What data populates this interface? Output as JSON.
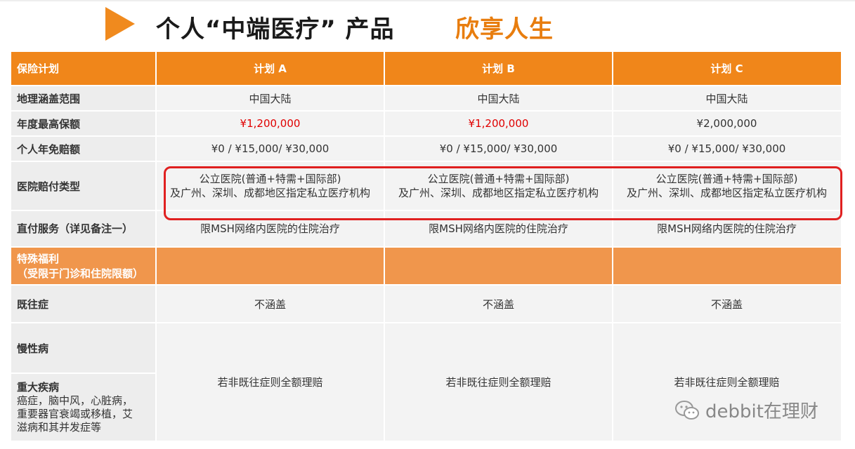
{
  "header": {
    "title_main": "个人“中端医疗” 产品",
    "title_accent": "欣享人生"
  },
  "table": {
    "col_header": [
      "保险计划",
      "计划 A",
      "计划 B",
      "计划 C"
    ],
    "rows": {
      "region": {
        "label": "地理涵盖范围",
        "values": [
          "中国大陆",
          "中国大陆",
          "中国大陆"
        ]
      },
      "annual_limit": {
        "label": "年度最高保额",
        "values": [
          "¥1,200,000",
          "¥1,200,000",
          "¥2,000,000"
        ]
      },
      "deductible": {
        "label": "个人年免赔额",
        "values": [
          "¥0 / ¥15,000/ ¥30,000",
          "¥0 / ¥15,000/ ¥30,000",
          "¥0 / ¥15,000/ ¥30,000"
        ]
      },
      "hospital": {
        "label": "医院赔付类型",
        "line1": "公立医院(普通+特需+国际部)",
        "line2": "及广州、深圳、成都地区指定私立医疗机构"
      },
      "direct_pay": {
        "label": "直付服务（详见备注一）",
        "values": [
          "限MSH网络内医院的住院治疗",
          "限MSH网络内医院的住院治疗",
          "限MSH网络内医院的住院治疗"
        ]
      },
      "special": {
        "line1": "特殊福利",
        "line2": "（受限于门诊和住院限额）"
      },
      "preexisting": {
        "label": "既往症",
        "values": [
          "不涵盖",
          "不涵盖",
          "不涵盖"
        ]
      },
      "chronic": {
        "label": "慢性病"
      },
      "critical": {
        "label": "重大疾病",
        "desc_lines": [
          "癌症，脑中风，心脏病，",
          "重要器官衰竭或移植，艾",
          "滋病和其并发症等"
        ],
        "values": [
          "若非既往症则全额理赔",
          "若非既往症则全额理赔",
          "若非既往症则全额理赔"
        ]
      }
    }
  },
  "colors": {
    "header_orange": "#F0861A",
    "accent": "#E87D0E",
    "highlight_red": "#E02020",
    "price_red": "#E00000"
  },
  "watermark": {
    "icon": "wechat-icon",
    "text": "debbit在理财"
  }
}
